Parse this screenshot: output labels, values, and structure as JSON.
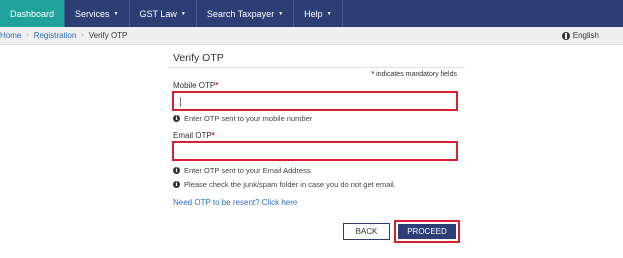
{
  "nav": {
    "items": [
      {
        "label": "Dashboard",
        "active": true,
        "has_caret": false
      },
      {
        "label": "Services",
        "active": false,
        "has_caret": true
      },
      {
        "label": "GST Law",
        "active": false,
        "has_caret": true
      },
      {
        "label": "Search Taxpayer",
        "active": false,
        "has_caret": true
      },
      {
        "label": "Help",
        "active": false,
        "has_caret": true
      }
    ],
    "caret_glyph": "▼"
  },
  "breadcrumb": {
    "items": [
      "Home",
      "Registration",
      "Verify OTP"
    ],
    "separator": "›"
  },
  "language": {
    "label": "English",
    "icon": "globe-icon"
  },
  "form": {
    "title": "Verify OTP",
    "mandatory_note": "indicates mandatory fields",
    "required_mark": "*",
    "mobile": {
      "label": "Mobile OTP",
      "value": "",
      "hint": "Enter OTP sent to your mobile number"
    },
    "email": {
      "label": "Email OTP",
      "value": "",
      "hint": "Enter OTP sent to your Email Address",
      "hint2": "Please check the junk/spam folder in case you do not get email."
    },
    "resend_link": "Need OTP to be resent? Click here",
    "back_label": "BACK",
    "proceed_label": "PROCEED",
    "info_glyph": "i"
  },
  "colors": {
    "nav_bg": "#2c3e73",
    "nav_active": "#1fa39a",
    "highlight_red": "#d6212e",
    "link_blue": "#2c6fb5"
  }
}
